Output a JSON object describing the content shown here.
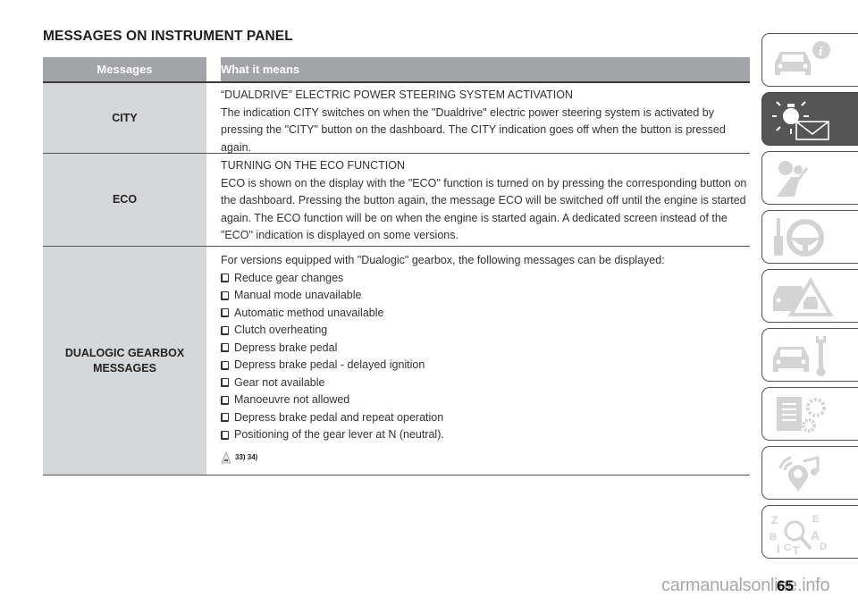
{
  "page": {
    "title": "MESSAGES ON INSTRUMENT PANEL",
    "page_number": "65",
    "watermark": "carmanualsonline.info"
  },
  "table": {
    "headers": {
      "messages": "Messages",
      "meaning": "What it means"
    },
    "rows": [
      {
        "message": "CITY",
        "heading": "“DUALDRIVE” ELECTRIC POWER STEERING SYSTEM ACTIVATION",
        "text": "The indication CITY switches on when the \"Dualdrive\" electric power steering system is activated by pressing the \"CITY\" button on the dashboard. The CITY indication goes off when the button is pressed again."
      },
      {
        "message": "ECO",
        "heading": "TURNING ON THE ECO FUNCTION",
        "text": "ECO is shown on the display with the \"ECO\" function is turned on by pressing the corresponding button on the dashboard. Pressing the button again, the message ECO will be switched off until the engine is started again. The ECO function will be on when the engine is started again. A dedicated screen instead of the \"ECO\" indication is displayed on some versions."
      },
      {
        "message_line1": "DUALOGIC GEARBOX",
        "message_line2": "MESSAGES",
        "intro": "For versions equipped with \"Dualogic\" gearbox, the following messages can be displayed:",
        "items": [
          "Reduce gear changes",
          "Manual mode unavailable",
          "Automatic method unavailable",
          "Clutch overheating",
          "Depress brake pedal",
          "Depress brake pedal - delayed ignition",
          "Gear not available",
          "Manoeuvre not allowed",
          "Depress brake pedal and repeat operation",
          "Positioning of the gear lever at N (neutral)."
        ],
        "warning_refs": "33) 34)"
      }
    ]
  },
  "sidebar": {
    "tabs": [
      {
        "icon": "car-info-icon",
        "active": false
      },
      {
        "icon": "warning-light-message-icon",
        "active": true
      },
      {
        "icon": "airbag-seatbelt-icon",
        "active": false
      },
      {
        "icon": "key-steering-wheel-icon",
        "active": false
      },
      {
        "icon": "car-hazard-icon",
        "active": false
      },
      {
        "icon": "car-wrench-icon",
        "active": false
      },
      {
        "icon": "specs-gear-icon",
        "active": false
      },
      {
        "icon": "multimedia-music-icon",
        "active": false
      },
      {
        "icon": "alphabetical-index-icon",
        "active": false
      }
    ]
  },
  "colors": {
    "header_bg": "#a3a4a7",
    "message_cell_bg": "#d6d7d9",
    "active_tab_bg": "#555555",
    "icon_light": "#d4d4d4"
  }
}
